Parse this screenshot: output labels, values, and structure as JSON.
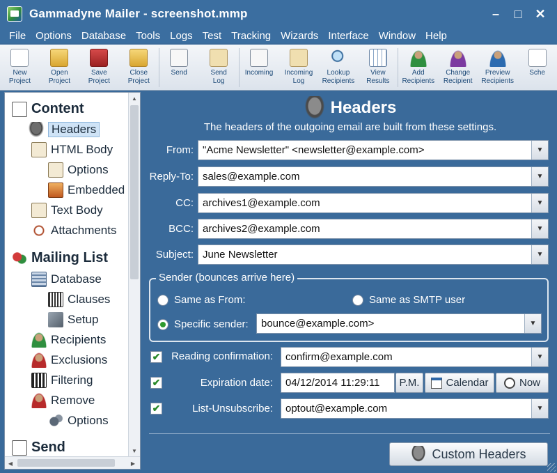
{
  "window": {
    "title": "Gammadyne Mailer - screenshot.mmp",
    "minimize": "–",
    "maximize": "□",
    "close": "✕"
  },
  "menu": [
    "File",
    "Options",
    "Database",
    "Tools",
    "Logs",
    "Test",
    "Tracking",
    "Wizards",
    "Interface",
    "Window",
    "Help"
  ],
  "toolbar": [
    {
      "label": "New\nProject",
      "icon": "new-project-icon"
    },
    {
      "label": "Open\nProject",
      "icon": "open-project-icon"
    },
    {
      "label": "Save\nProject",
      "icon": "save-project-icon"
    },
    {
      "label": "Close\nProject",
      "icon": "close-project-icon"
    },
    {
      "label": "Send",
      "icon": "send-icon"
    },
    {
      "label": "Send\nLog",
      "icon": "send-log-icon"
    },
    {
      "label": "Incoming",
      "icon": "incoming-icon"
    },
    {
      "label": "Incoming\nLog",
      "icon": "incoming-log-icon"
    },
    {
      "label": "Lookup\nRecipients",
      "icon": "lookup-recipients-icon"
    },
    {
      "label": "View\nResults",
      "icon": "view-results-icon"
    },
    {
      "label": "Add\nRecipients",
      "icon": "add-recipients-icon"
    },
    {
      "label": "Change\nRecipient",
      "icon": "change-recipient-icon"
    },
    {
      "label": "Preview\nRecipients",
      "icon": "preview-recipients-icon"
    },
    {
      "label": "Sche",
      "icon": "schedule-icon"
    }
  ],
  "tree": {
    "content": "Content",
    "headers": "Headers",
    "html_body": "HTML Body",
    "options": "Options",
    "embedded": "Embedded",
    "text_body": "Text Body",
    "attachments": "Attachments",
    "mailing_list": "Mailing List",
    "database": "Database",
    "clauses": "Clauses",
    "setup": "Setup",
    "recipients": "Recipients",
    "exclusions": "Exclusions",
    "filtering": "Filtering",
    "remove": "Remove",
    "remove_options": "Options",
    "send": "Send"
  },
  "headers": {
    "title": "Headers",
    "description": "The headers of the outgoing email are built from these settings.",
    "from_label": "From:",
    "from_value": "\"Acme Newsletter\" <newsletter@example.com>",
    "reply_to_label": "Reply-To:",
    "reply_to_value": "sales@example.com",
    "cc_label": "CC:",
    "cc_value": "archives1@example.com",
    "bcc_label": "BCC:",
    "bcc_value": "archives2@example.com",
    "subject_label": "Subject:",
    "subject_value": "June Newsletter"
  },
  "sender": {
    "legend": "Sender (bounces arrive here)",
    "same_as_from": "Same as From:",
    "same_as_smtp": "Same as SMTP user",
    "specific": "Specific sender:",
    "specific_value": "bounce@example.com>",
    "selected": "specific"
  },
  "options": {
    "reading_label": "Reading confirmation:",
    "reading_value": "confirm@example.com",
    "reading_checked": true,
    "expiration_label": "Expiration date:",
    "expiration_value": "04/12/2014 11:29:11",
    "pm_label": "P.M.",
    "calendar_label": "Calendar",
    "now_label": "Now",
    "expiration_checked": true,
    "unsubscribe_label": "List-Unsubscribe:",
    "unsubscribe_value": "optout@example.com",
    "unsubscribe_checked": true,
    "check_mark": "✔"
  },
  "custom_headers": "Custom Headers",
  "combo_arrow": "▼",
  "colors": {
    "frame": "#3b6ea0",
    "panel": "#3a6a9a",
    "selected": "#cfe3f6",
    "check": "#2a8a2a"
  }
}
